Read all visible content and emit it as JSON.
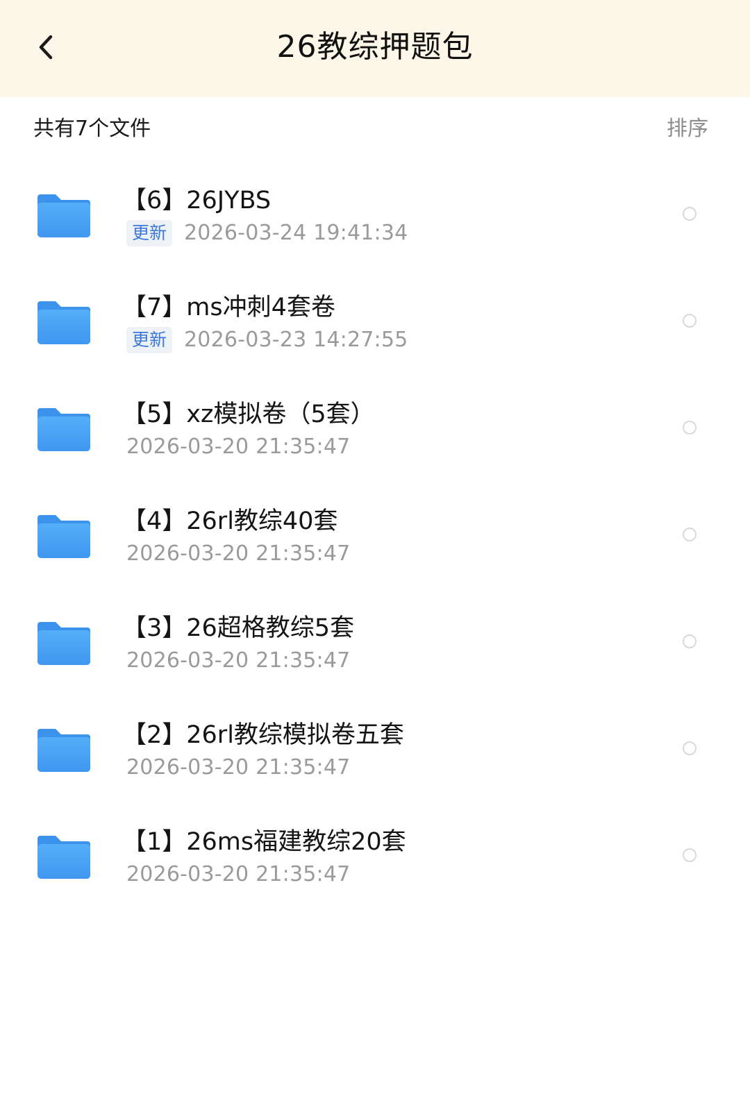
{
  "header": {
    "title": "26教综押题包",
    "back_icon": "chevron-left-icon",
    "background": "#fdf7ea"
  },
  "summary": {
    "count_text": "共有7个文件",
    "sort_label": "排序"
  },
  "colors": {
    "folder": "#4aa3f5",
    "badge_text": "#3b78d8",
    "timestamp": "#9a9a9a"
  },
  "files": [
    {
      "name": "【6】26JYBS",
      "badge": "更新",
      "time": "2026-03-24  19:41:34",
      "icon": "folder-icon"
    },
    {
      "name": "【7】ms冲刺4套卷",
      "badge": "更新",
      "time": "2026-03-23  14:27:55",
      "icon": "folder-icon"
    },
    {
      "name": "【5】xz模拟卷（5套）",
      "badge": "",
      "time": "2026-03-20  21:35:47",
      "icon": "folder-icon"
    },
    {
      "name": "【4】26rl教综40套",
      "badge": "",
      "time": "2026-03-20  21:35:47",
      "icon": "folder-icon"
    },
    {
      "name": "【3】26超格教综5套",
      "badge": "",
      "time": "2026-03-20  21:35:47",
      "icon": "folder-icon"
    },
    {
      "name": "【2】26rl教综模拟卷五套",
      "badge": "",
      "time": "2026-03-20  21:35:47",
      "icon": "folder-icon"
    },
    {
      "name": "【1】26ms福建教综20套",
      "badge": "",
      "time": "2026-03-20  21:35:47",
      "icon": "folder-icon"
    }
  ]
}
